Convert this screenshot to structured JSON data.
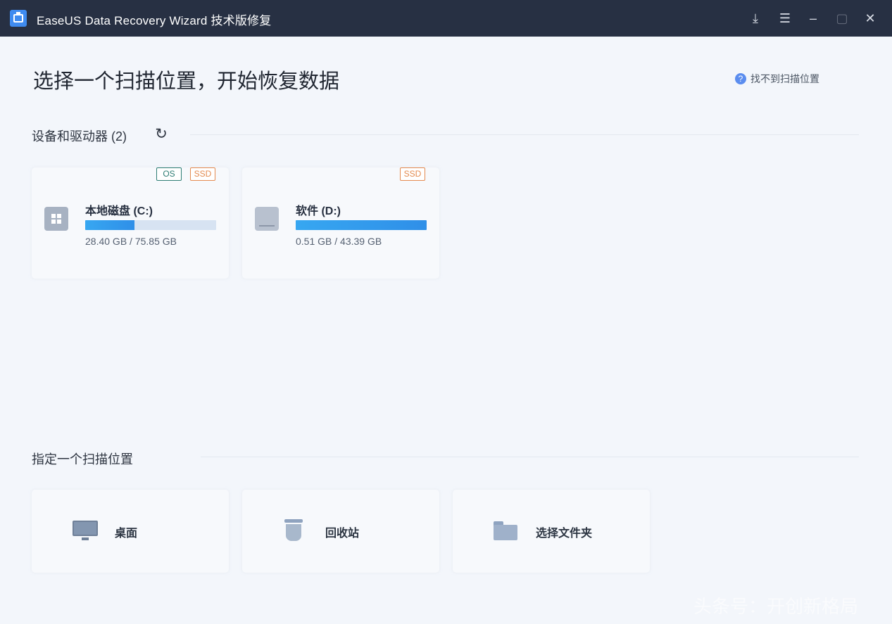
{
  "window": {
    "title": "EaseUS Data Recovery Wizard 技术版修复",
    "controls": [
      "export-icon",
      "menu-icon",
      "minimize-icon",
      "maximize-icon",
      "close-icon"
    ]
  },
  "page": {
    "heading": "选择一个扫描位置，开始恢复数据",
    "help_link": "找不到扫描位置"
  },
  "devices": {
    "title": "设备和驱动器 (2)",
    "drives": [
      {
        "name": "本地磁盘 (C:)",
        "size": "28.40 GB / 75.85 GB",
        "used_fraction": 0.374,
        "badges": [
          "OS",
          "SSD"
        ],
        "icon": "windows-drive-icon"
      },
      {
        "name": "软件 (D:)",
        "size": "0.51 GB / 43.39 GB",
        "used_fraction": 1.0,
        "badges": [
          "SSD"
        ],
        "icon": "drive-icon"
      }
    ]
  },
  "locations": {
    "title": "指定一个扫描位置",
    "items": [
      {
        "label": "桌面",
        "icon": "desktop-icon"
      },
      {
        "label": "回收站",
        "icon": "recycle-bin-icon"
      },
      {
        "label": "选择文件夹",
        "icon": "folder-icon"
      }
    ]
  },
  "watermark": "头条号：开创新格局",
  "colors": {
    "titlebar": "#273043",
    "accent": "#2f8fe8",
    "os_badge": "#2e7d74",
    "ssd_badge": "#e48b50"
  }
}
